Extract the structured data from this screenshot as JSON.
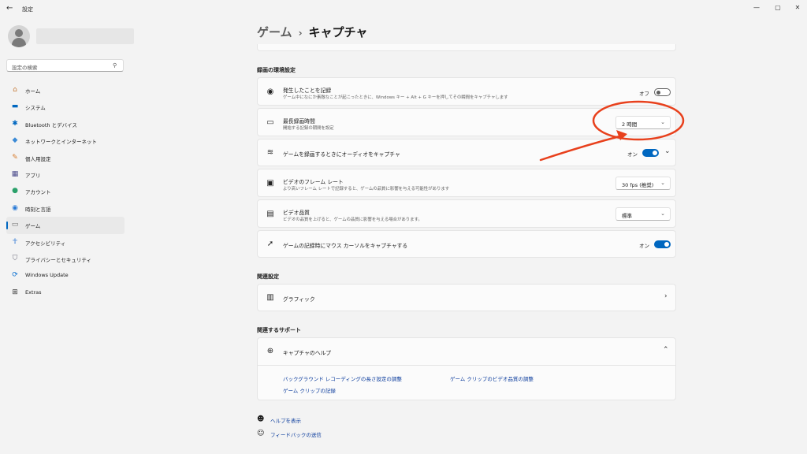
{
  "titlebar": {
    "app_title": "設定",
    "minimize": "—",
    "maximize": "▢",
    "close": "✕"
  },
  "sidebar": {
    "search_placeholder": "設定の検索",
    "items": [
      {
        "label": "ホーム",
        "icon": "home-icon",
        "color": "#c57b3a"
      },
      {
        "label": "システム",
        "icon": "system-icon",
        "color": "#0067c0"
      },
      {
        "label": "Bluetooth とデバイス",
        "icon": "bluetooth-icon",
        "color": "#0067c0"
      },
      {
        "label": "ネットワークとインターネット",
        "icon": "network-icon",
        "color": "#3a8ad6"
      },
      {
        "label": "個人用設定",
        "icon": "brush-icon",
        "color": "#d67a2a"
      },
      {
        "label": "アプリ",
        "icon": "apps-icon",
        "color": "#4a4a8a"
      },
      {
        "label": "アカウント",
        "icon": "account-icon",
        "color": "#2aa06a"
      },
      {
        "label": "時刻と言語",
        "icon": "time-language-icon",
        "color": "#2a7ad6"
      },
      {
        "label": "ゲーム",
        "icon": "gaming-icon",
        "color": "#6a6a6a"
      },
      {
        "label": "アクセシビリティ",
        "icon": "accessibility-icon",
        "color": "#1a6ad0"
      },
      {
        "label": "プライバシーとセキュリティ",
        "icon": "shield-icon",
        "color": "#6a6a7a"
      },
      {
        "label": "Windows Update",
        "icon": "update-icon",
        "color": "#0a70d0"
      },
      {
        "label": "Extras",
        "icon": "extras-icon",
        "color": "#333333"
      }
    ],
    "active_index": 8
  },
  "breadcrumb": {
    "parent": "ゲーム",
    "separator": "›",
    "current": "キャプチャ"
  },
  "sections": {
    "recording": "録画の環境設定",
    "related_settings": "関連設定",
    "related_support": "関連するサポート"
  },
  "settings": {
    "record_what_happened": {
      "title": "発生したことを記録",
      "desc": "ゲーム中になにか素敵なことが起こったときに、Windows キー + Alt + G キーを押してその瞬間をキャプチャします",
      "toggle_label": "オフ"
    },
    "max_recording_length": {
      "title": "最長録画時間",
      "desc": "開始する記録の期間を設定",
      "value": "2 時間"
    },
    "capture_audio": {
      "title": "ゲームを録画するときにオーディオをキャプチャ",
      "toggle_label": "オン"
    },
    "frame_rate": {
      "title": "ビデオのフレーム レート",
      "desc": "より高いフレーム レートで記録すると、ゲームの品質に影響を与える可能性があります",
      "value": "30 fps (推奨)"
    },
    "video_quality": {
      "title": "ビデオ品質",
      "desc": "ビデオの品質を上げると、ゲームの品質に影響を与える場合があります。",
      "value": "標準"
    },
    "capture_cursor": {
      "title": "ゲームの記録時にマウス カーソルをキャプチャする",
      "toggle_label": "オン"
    }
  },
  "related": {
    "graphics": "グラフィック"
  },
  "support": {
    "help_title": "キャプチャのヘルプ",
    "links": [
      "バックグラウンド レコーディングの長さ設定の調整",
      "ゲーム クリップのビデオ品質の調整",
      "ゲーム クリップの記録"
    ]
  },
  "footer": {
    "get_help": "ヘルプを表示",
    "feedback": "フィードバックの送信"
  },
  "colors": {
    "accent": "#0067c0",
    "annotation": "#e8401c"
  }
}
